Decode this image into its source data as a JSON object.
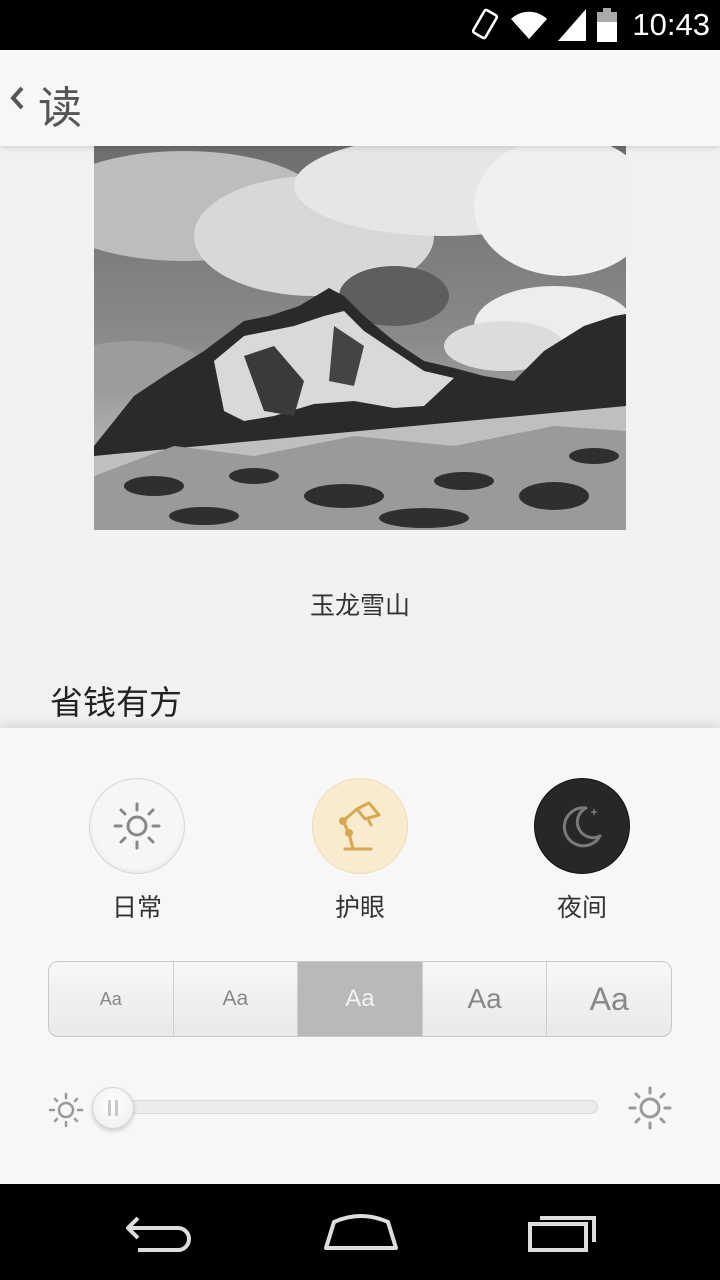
{
  "status_bar": {
    "time": "10:43"
  },
  "action_bar": {
    "title": "读"
  },
  "article": {
    "photo_caption": "玉龙雪山",
    "next_heading": "省钱有方"
  },
  "reading_modes": [
    {
      "label": "日常",
      "icon": "sun-icon"
    },
    {
      "label": "护眼",
      "icon": "desk-lamp-icon"
    },
    {
      "label": "夜间",
      "icon": "moon-icon"
    }
  ],
  "font_sizes": {
    "options": [
      "Aa",
      "Aa",
      "Aa",
      "Aa",
      "Aa"
    ],
    "selected_index": 2
  },
  "brightness": {
    "level": 0.05
  },
  "colors": {
    "eye_mode_accent": "#d9a84e",
    "night_mode": "#272727",
    "selected_segment": "#b9b9bb"
  }
}
